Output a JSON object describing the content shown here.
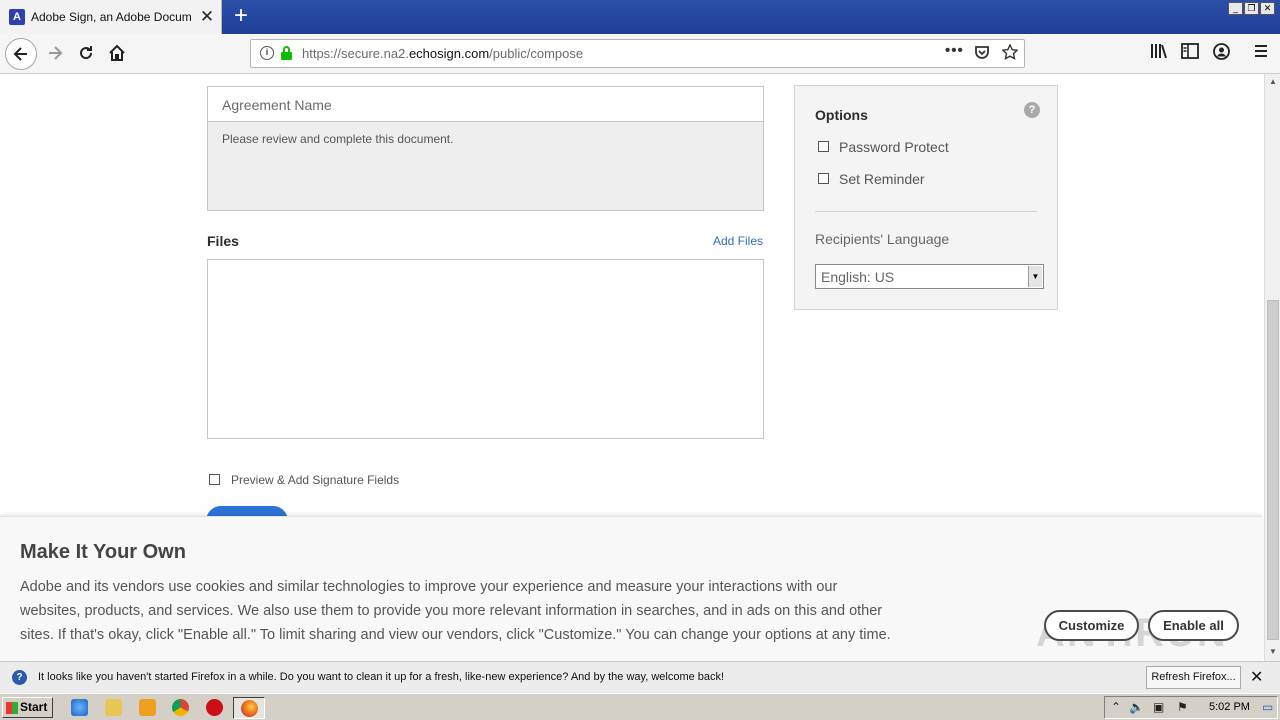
{
  "browser": {
    "tab_title": "Adobe Sign, an Adobe Document Cloud",
    "tab_close": "✕",
    "new_tab": "+",
    "url_prefix": "https://secure.na2.",
    "url_domain": "echosign.com",
    "url_path": "/public/compose",
    "window_buttons": [
      "_",
      "❐",
      "✕"
    ]
  },
  "form": {
    "agreement_name_placeholder": "Agreement Name",
    "message": "Please review and complete this document.",
    "files_label": "Files",
    "add_files": "Add Files",
    "preview_label": "Preview & Add Signature Fields",
    "preview_checked": false
  },
  "options": {
    "title": "Options",
    "help": "?",
    "password_protect": "Password Protect",
    "set_reminder": "Set Reminder",
    "language_label": "Recipients' Language",
    "language_value": "English: US"
  },
  "cookie": {
    "title": "Make It Your Own",
    "text": "Adobe and its vendors use cookies and similar technologies to improve your experience and measure your interactions with our websites, products, and services. We also use them to provide you more relevant information in searches, and in ads on this and other sites. If that's okay, click \"Enable all.\" To limit sharing and view our vendors, click \"Customize.\" You can change your options at any time.",
    "customize": "Customize",
    "enable_all": "Enable all",
    "watermark": "ANY.RUN"
  },
  "notification": {
    "message": "It looks like you haven't started Firefox in a while. Do you want to clean it up for a fresh, like-new experience? And by the way, welcome back!",
    "refresh_button": "Refresh Firefox...",
    "close": "✕"
  },
  "taskbar": {
    "start": "Start",
    "clock": "5:02 PM"
  },
  "colors": {
    "accent_blue": "#2d73d6",
    "link_blue": "#2d6fb6",
    "titlebar": "#2c4fa8",
    "secure_green": "#12bc00"
  }
}
